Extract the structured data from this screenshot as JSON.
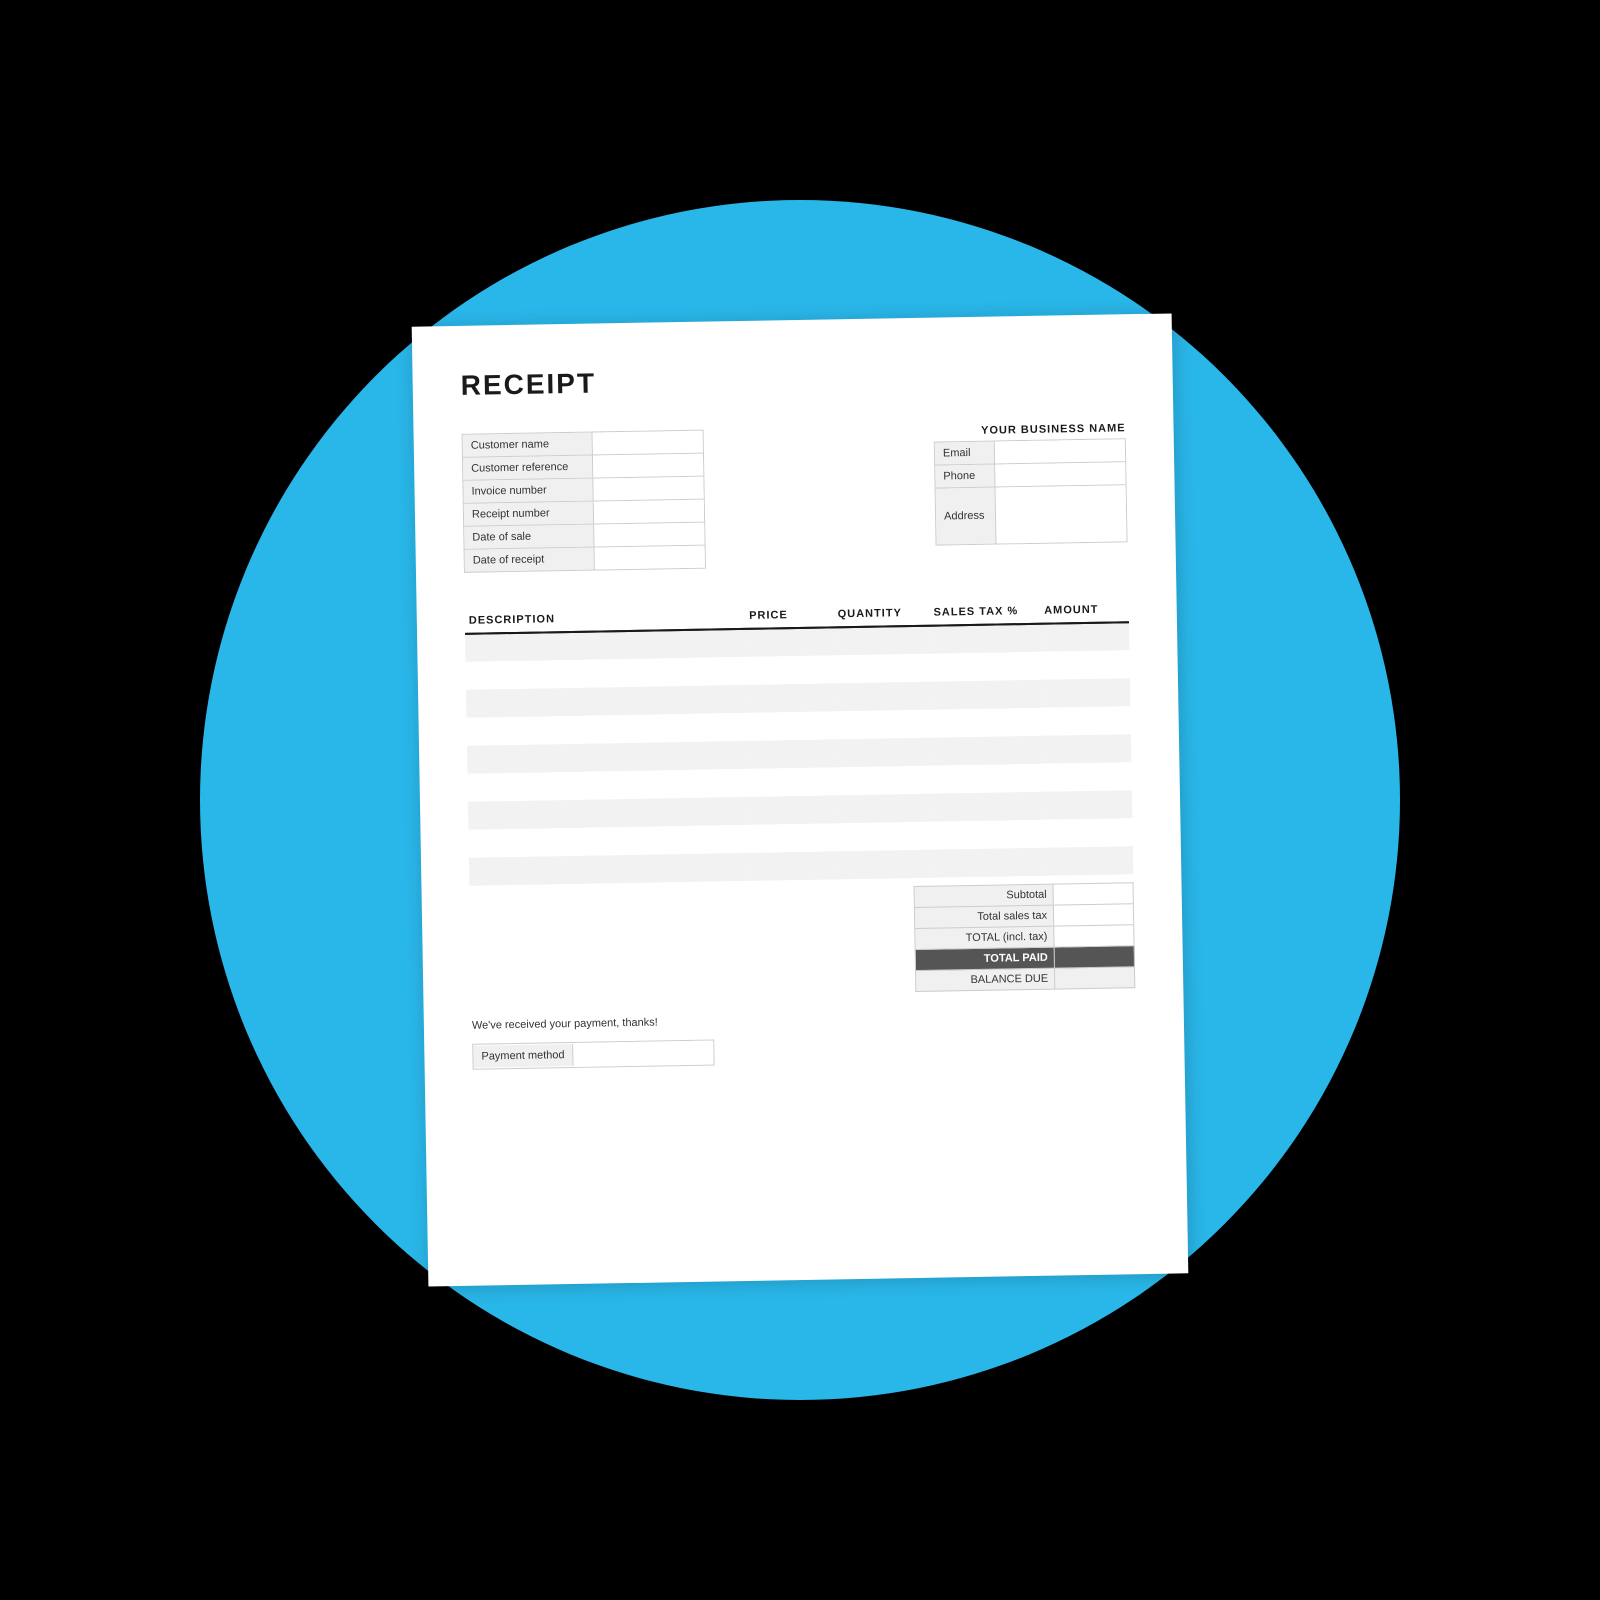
{
  "title": "RECEIPT",
  "left_fields": [
    {
      "label": "Customer name",
      "value": ""
    },
    {
      "label": "Customer reference",
      "value": ""
    },
    {
      "label": "Invoice number",
      "value": ""
    },
    {
      "label": "Receipt number",
      "value": ""
    },
    {
      "label": "Date of sale",
      "value": ""
    },
    {
      "label": "Date of receipt",
      "value": ""
    }
  ],
  "business": {
    "name": "YOUR BUSINESS NAME",
    "fields": [
      {
        "label": "Email",
        "value": ""
      },
      {
        "label": "Phone",
        "value": ""
      },
      {
        "label": "Address",
        "value": "",
        "multiline": true
      }
    ]
  },
  "table": {
    "columns": [
      {
        "key": "description",
        "label": "DESCRIPTION"
      },
      {
        "key": "price",
        "label": "PRICE"
      },
      {
        "key": "quantity",
        "label": "QUANTITY"
      },
      {
        "key": "sales_tax",
        "label": "SALES TAX %"
      },
      {
        "key": "amount",
        "label": "AMOUNT"
      }
    ],
    "rows": 9
  },
  "totals": [
    {
      "label": "Subtotal",
      "value": ""
    },
    {
      "label": "Total sales tax",
      "value": ""
    },
    {
      "label": "TOTAL (incl. tax)",
      "value": ""
    },
    {
      "label": "TOTAL PAID",
      "value": "",
      "style": "paid"
    },
    {
      "label": "BALANCE DUE",
      "value": "",
      "style": "due"
    }
  ],
  "thank_you_message": "We've received your payment, thanks!",
  "payment_method_label": "Payment method"
}
